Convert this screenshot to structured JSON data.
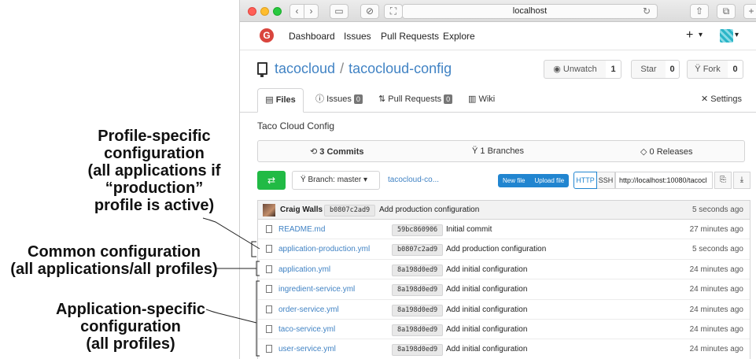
{
  "annotations": [
    {
      "lines": [
        "Profile-specific",
        "configuration",
        "(all applications if",
        "“production”",
        "profile is active)"
      ]
    },
    {
      "lines": [
        "Common configuration",
        "(all applications/all profiles)"
      ]
    },
    {
      "lines": [
        "Application-specific",
        "configuration",
        "(all profiles)"
      ]
    }
  ],
  "browser": {
    "url": "localhost",
    "reload_icon": "reload-icon",
    "back_icon": "chevron-left-icon",
    "forward_icon": "chevron-right-icon"
  },
  "navbar": {
    "logo": "G",
    "items": [
      "Dashboard",
      "Issues",
      "Pull Requests",
      "Explore"
    ],
    "plus": "+",
    "caret": "▾"
  },
  "repo": {
    "owner": "tacocloud",
    "separator": "/",
    "name": "tacocloud-config",
    "unwatch_label": "Unwatch",
    "unwatch_count": "1",
    "star_label": "Star",
    "star_count": "0",
    "fork_label": "Fork",
    "fork_count": "0"
  },
  "tabs": {
    "files": "Files",
    "issues": "Issues",
    "issues_count": "0",
    "pulls": "Pull Requests",
    "pulls_count": "0",
    "wiki": "Wiki",
    "settings": "Settings"
  },
  "description": "Taco Cloud Config",
  "stats": {
    "commits": "3 Commits",
    "branches": "1 Branches",
    "releases": "0 Releases"
  },
  "toolbar": {
    "branch_label": "Branch: master",
    "path": "tacocloud-co...",
    "new_file": "New file",
    "upload_file": "Upload file",
    "http": "HTTP",
    "ssh": "SSH",
    "clone_url": "http://localhost:10080/tacocl"
  },
  "latest_commit": {
    "author": "Craig Walls",
    "sha": "b0807c2ad9",
    "message": "Add production configuration",
    "time": "5 seconds ago"
  },
  "files": [
    {
      "name": "README.md",
      "sha": "59bc860906",
      "message": "Initial commit",
      "time": "27 minutes ago"
    },
    {
      "name": "application-production.yml",
      "sha": "b0807c2ad9",
      "message": "Add production configuration",
      "time": "5 seconds ago"
    },
    {
      "name": "application.yml",
      "sha": "8a198d0ed9",
      "message": "Add initial configuration",
      "time": "24 minutes ago"
    },
    {
      "name": "ingredient-service.yml",
      "sha": "8a198d0ed9",
      "message": "Add initial configuration",
      "time": "24 minutes ago"
    },
    {
      "name": "order-service.yml",
      "sha": "8a198d0ed9",
      "message": "Add initial configuration",
      "time": "24 minutes ago"
    },
    {
      "name": "taco-service.yml",
      "sha": "8a198d0ed9",
      "message": "Add initial configuration",
      "time": "24 minutes ago"
    },
    {
      "name": "user-service.yml",
      "sha": "8a198d0ed9",
      "message": "Add initial configuration",
      "time": "24 minutes ago"
    }
  ]
}
